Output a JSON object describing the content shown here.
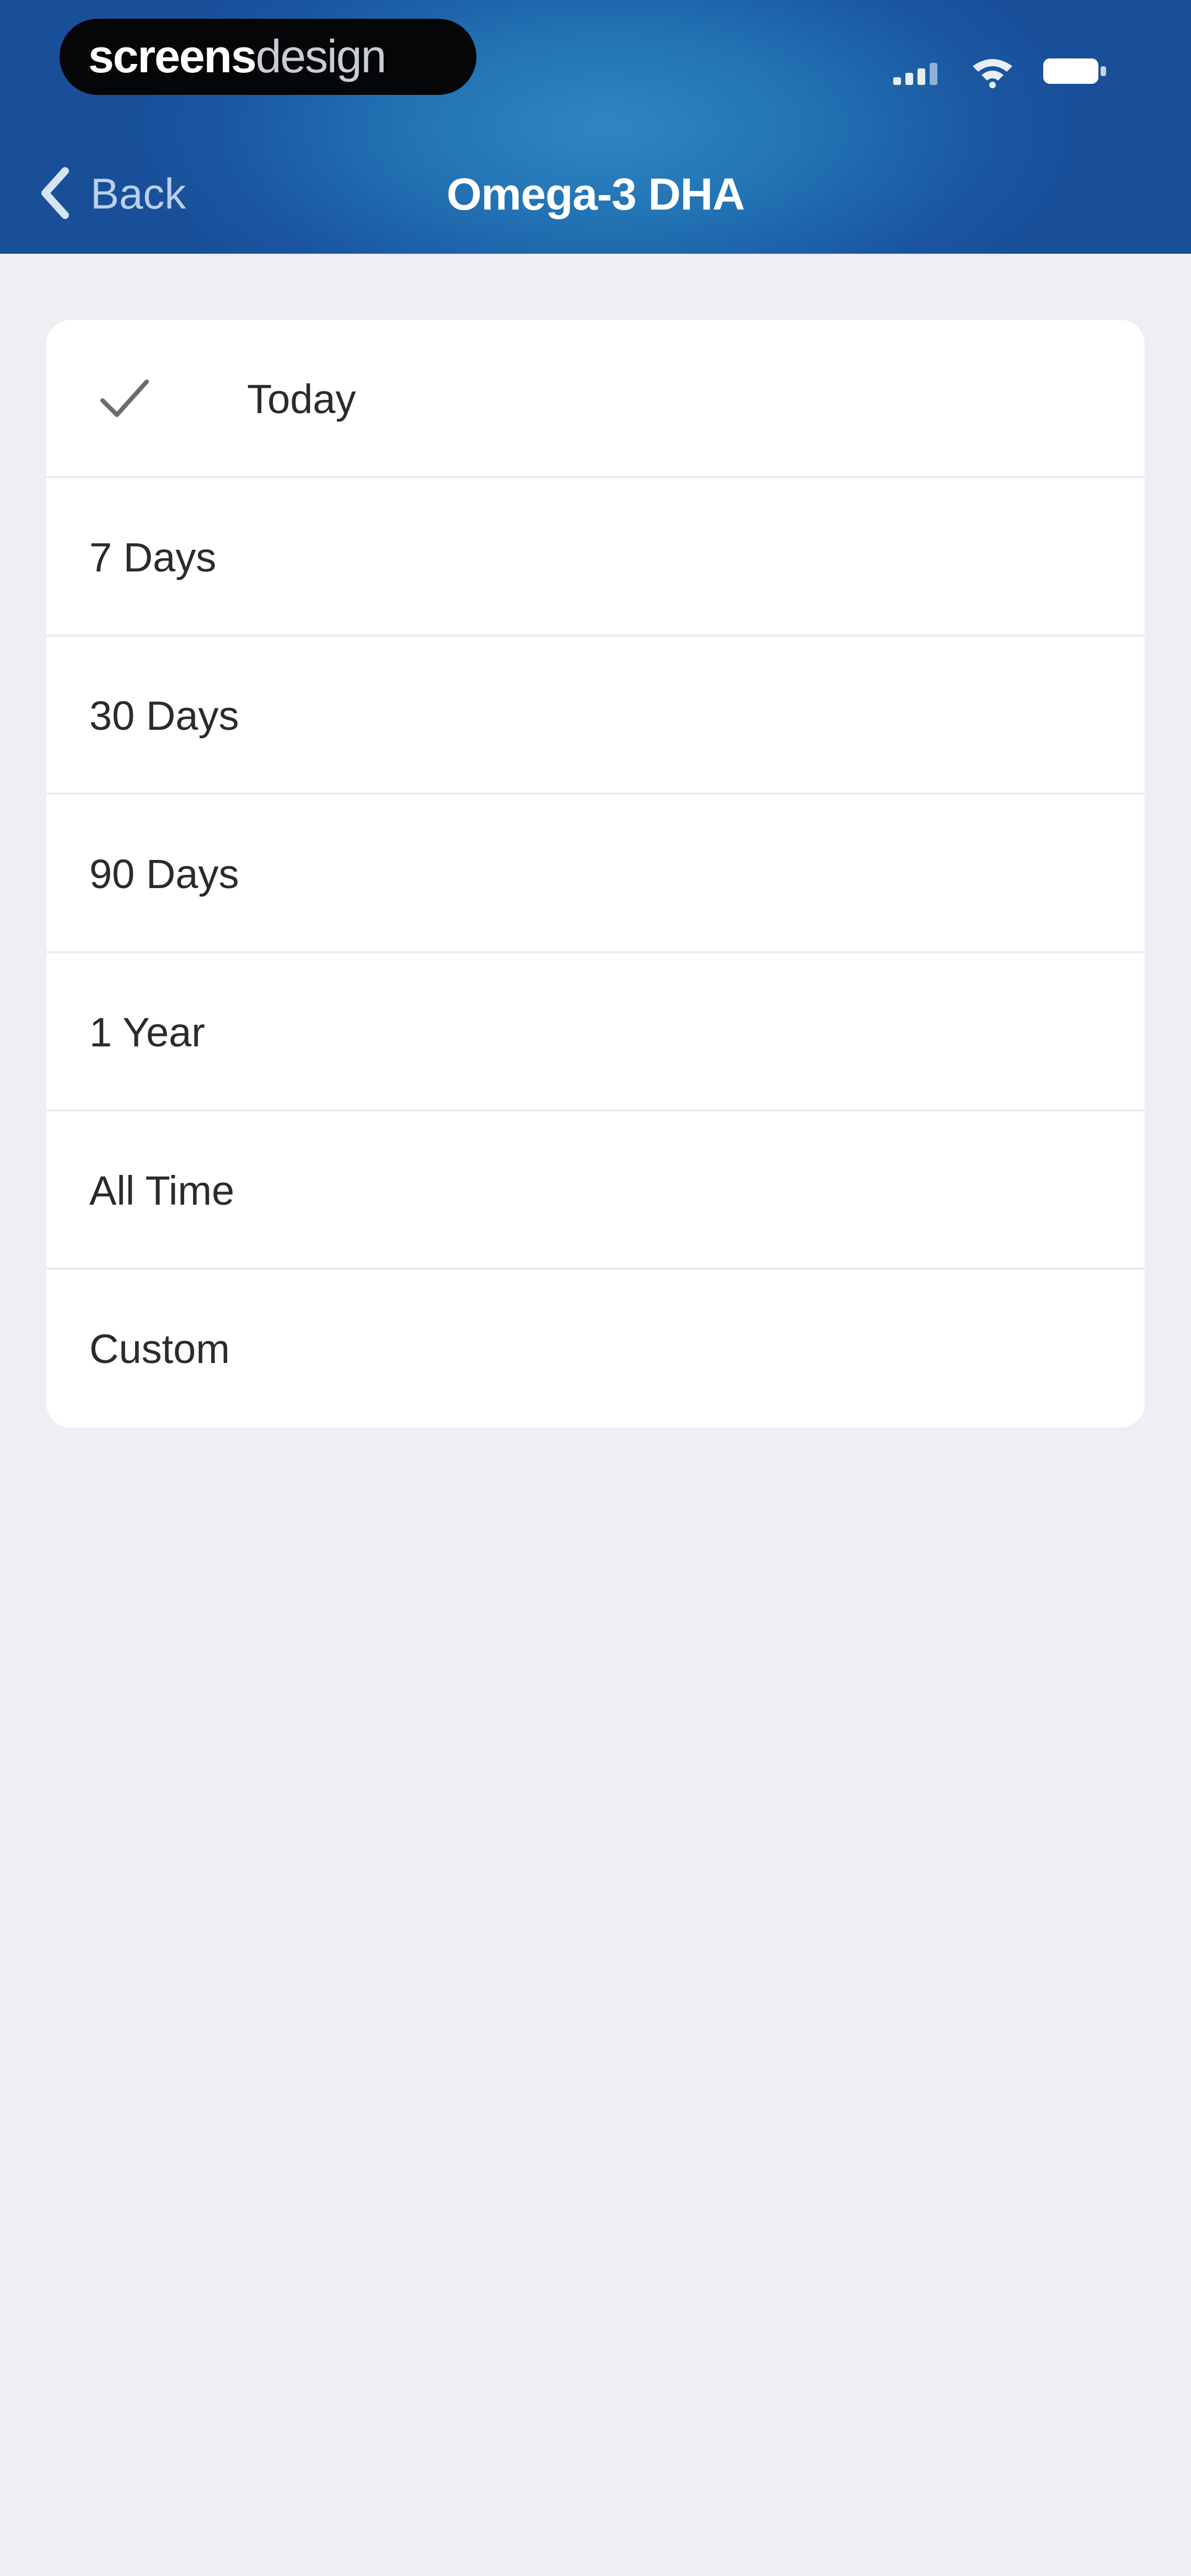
{
  "status_bar": {
    "brand_strong": "screens",
    "brand_light": "design",
    "icons": [
      "signal-icon",
      "wifi-icon",
      "battery-icon"
    ]
  },
  "nav": {
    "back_label": "Back",
    "title": "Omega-3 DHA"
  },
  "range_options": {
    "selected": "Today",
    "items": [
      {
        "label": "Today",
        "selected": true
      },
      {
        "label": "7 Days",
        "selected": false
      },
      {
        "label": "30 Days",
        "selected": false
      },
      {
        "label": "90 Days",
        "selected": false
      },
      {
        "label": "1 Year",
        "selected": false
      },
      {
        "label": "All Time",
        "selected": false
      },
      {
        "label": "Custom",
        "selected": false
      }
    ]
  },
  "colors": {
    "header_blue": "#1f64ad",
    "background": "#efeef4",
    "card": "#ffffff",
    "text": "#2b2b2f",
    "back_text": "#b9d0ea"
  }
}
